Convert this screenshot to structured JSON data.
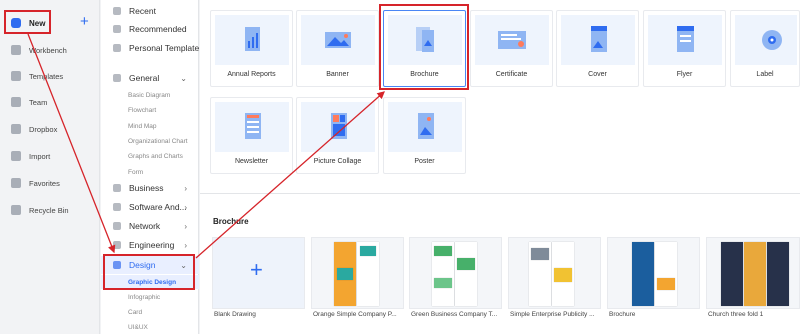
{
  "nav": {
    "new_label": "New",
    "plus": "+",
    "items": [
      "Workbench",
      "Templates",
      "Team",
      "Dropbox",
      "Import",
      "Favorites",
      "Recycle Bin"
    ]
  },
  "categories": {
    "top": [
      "Recent",
      "Recommended",
      "Personal Template"
    ],
    "general": {
      "label": "General",
      "chev": "⌄",
      "subs": [
        "Basic Diagram",
        "Flowchart",
        "Mind Map",
        "Organizational Chart",
        "Graphs and Charts",
        "Form"
      ]
    },
    "collapsed": [
      {
        "label": "Business",
        "chev": "›"
      },
      {
        "label": "Software And...",
        "chev": "›"
      },
      {
        "label": "Network",
        "chev": "›"
      },
      {
        "label": "Engineering",
        "chev": "›"
      }
    ],
    "design": {
      "label": "Design",
      "chev": "⌄",
      "subs": [
        "Graphic Design",
        "Infographic",
        "Card",
        "UI&UX"
      ]
    }
  },
  "types": [
    "Annual Reports",
    "Banner",
    "Brochure",
    "Certificate",
    "Cover",
    "Flyer",
    "Label",
    "Newsletter",
    "Picture Collage",
    "Poster"
  ],
  "section": {
    "title": "Brochure",
    "templates": [
      "Blank Drawing",
      "Orange Simple Company P...",
      "Green Business Company T...",
      "Simple Enterprise Publicity ...",
      "Brochure",
      "Church three fold 1"
    ],
    "blank_plus": "+"
  },
  "colors": {
    "accent": "#2f6cf0",
    "highlight": "#d6242a"
  }
}
